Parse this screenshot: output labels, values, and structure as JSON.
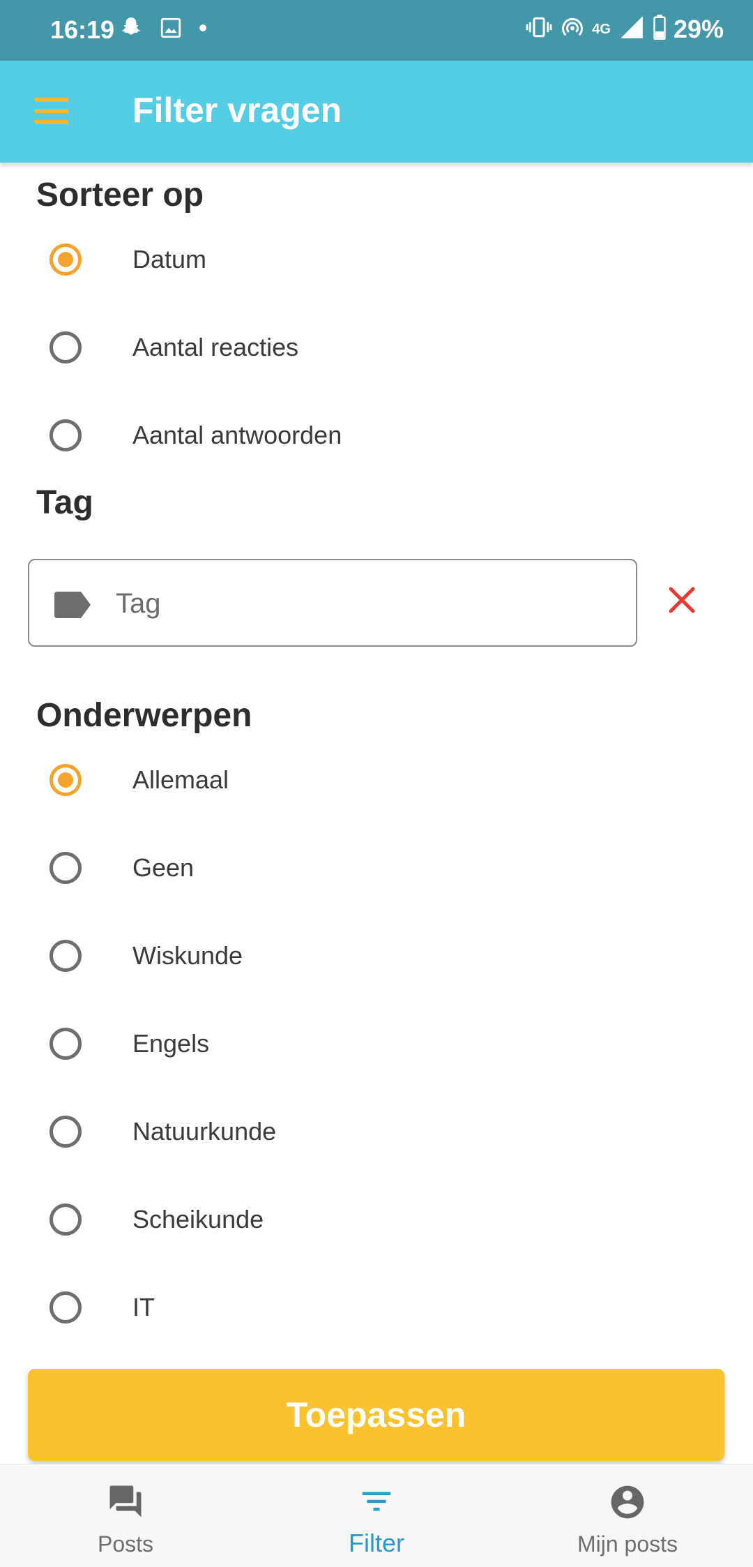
{
  "status_bar": {
    "time": "16:19",
    "network": "4G",
    "battery": "29%"
  },
  "app_bar": {
    "title": "Filter vragen"
  },
  "sort": {
    "title": "Sorteer op",
    "options": [
      "Datum",
      "Aantal reacties",
      "Aantal antwoorden"
    ],
    "selected": "Datum"
  },
  "tag": {
    "title": "Tag",
    "value": "",
    "placeholder": "Tag"
  },
  "subjects": {
    "title": "Onderwerpen",
    "options": [
      "Allemaal",
      "Geen",
      "Wiskunde",
      "Engels",
      "Natuurkunde",
      "Scheikunde",
      "IT"
    ],
    "selected": "Allemaal"
  },
  "apply_button": {
    "label": "Toepassen"
  },
  "bottom_nav": {
    "items": [
      {
        "label": "Posts",
        "icon": "chat-bubbles-icon"
      },
      {
        "label": "Filter",
        "icon": "filter-icon"
      },
      {
        "label": "Mijn posts",
        "icon": "account-icon"
      }
    ],
    "active": "Filter"
  },
  "colors": {
    "status_bar": "#4397a9",
    "app_bar": "#54cce4",
    "accent": "#f4a42c",
    "apply_button": "#fbc22f",
    "clear_icon": "#e53935",
    "active_nav": "#2899c9"
  }
}
